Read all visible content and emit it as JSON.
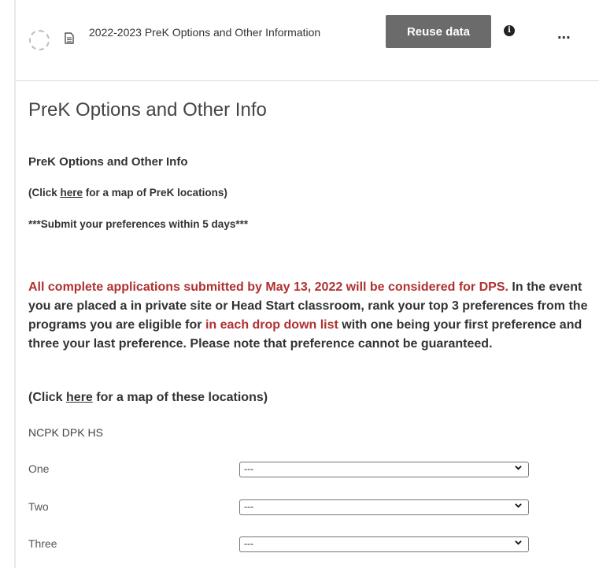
{
  "header": {
    "document_title": "2022-2023 PreK Options and Other Information",
    "reuse_button_label": "Reuse data",
    "info_glyph": "i",
    "more_glyph": "..."
  },
  "page": {
    "title": "PreK Options and Other Info",
    "section_heading": "PreK Options and Other Info",
    "map_line_1": {
      "prefix": "(Click ",
      "link": "here",
      "suffix": " for a map of PreK locations)"
    },
    "submit_reminder": "***Submit your preferences within 5 days***",
    "notice": {
      "red_1": "All complete applications submitted by May 13, 2022 will be considered for DPS.",
      "text_1": " In the event you are placed a in private site or Head Start classroom, rank your top 3 preferences from the programs you are eligible for ",
      "red_2": "in each drop down list",
      "text_2": " with one being your first preference and three your last preference. Please note that preference cannot be guaranteed."
    },
    "map_line_2": {
      "prefix": "(Click ",
      "link": "here",
      "suffix": " for a map of these locations)"
    },
    "programs_label": "NCPK DPK HS"
  },
  "preferences": [
    {
      "label": "One",
      "selected": "---"
    },
    {
      "label": "Two",
      "selected": "---"
    },
    {
      "label": "Three",
      "selected": "---"
    }
  ],
  "colors": {
    "accent_red": "#b03030",
    "button_gray": "#6b6b6b"
  },
  "icons": [
    "status-ring-icon",
    "document-icon",
    "info-icon",
    "more-icon",
    "chevron-down-icon"
  ]
}
